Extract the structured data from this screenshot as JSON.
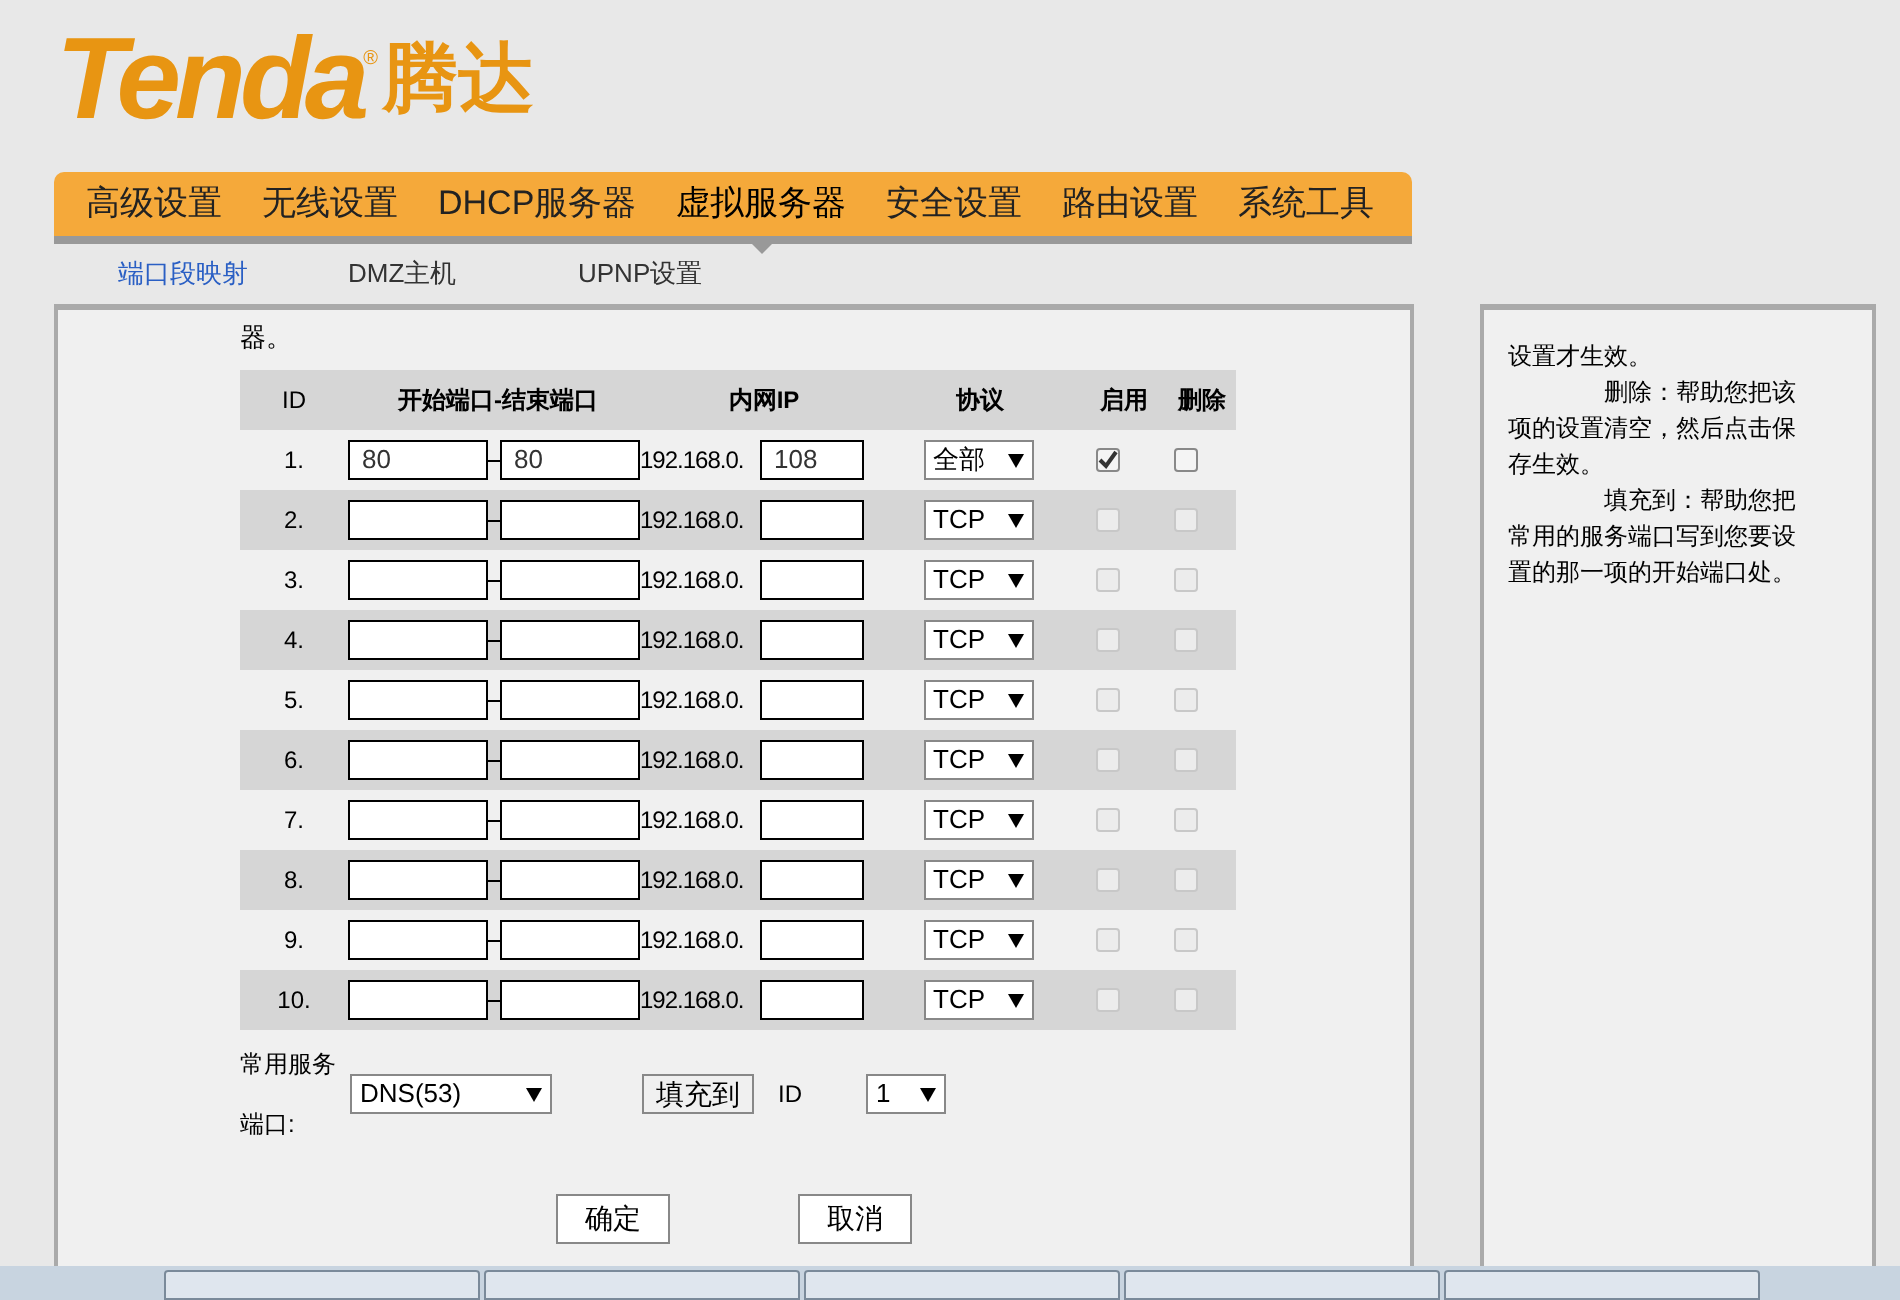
{
  "logo": {
    "brand": "Tenda",
    "mark": "®",
    "chinese": "腾达"
  },
  "nav": [
    {
      "label": "高级设置",
      "selected": false
    },
    {
      "label": "无线设置",
      "selected": false
    },
    {
      "label": "DHCP服务器",
      "selected": false
    },
    {
      "label": "虚拟服务器",
      "selected": true
    },
    {
      "label": "安全设置",
      "selected": false
    },
    {
      "label": "路由设置",
      "selected": false
    },
    {
      "label": "系统工具",
      "selected": false
    }
  ],
  "subtabs": [
    {
      "label": "端口段映射",
      "selected": true
    },
    {
      "label": "DMZ主机",
      "selected": false
    },
    {
      "label": "UPNP设置",
      "selected": false
    }
  ],
  "intro_tail": "器。",
  "table": {
    "columns": [
      "ID",
      "开始端口-结束端口",
      "内网IP",
      "协议",
      "启用",
      "删除"
    ],
    "rows": [
      {
        "id": "1.",
        "start": "80",
        "end": "80",
        "ip_prefix": "192.168.0.",
        "ip": "108",
        "protocol": "全部",
        "enabled": true,
        "enable_disabled": false,
        "delete": false
      },
      {
        "id": "2.",
        "ip_prefix": "192.168.0.",
        "protocol": "TCP",
        "enabled": false,
        "enable_disabled": true,
        "delete": false
      },
      {
        "id": "3.",
        "ip_prefix": "192.168.0.",
        "protocol": "TCP",
        "enabled": false,
        "enable_disabled": true,
        "delete": false
      },
      {
        "id": "4.",
        "ip_prefix": "192.168.0.",
        "protocol": "TCP",
        "enabled": false,
        "enable_disabled": true,
        "delete": false
      },
      {
        "id": "5.",
        "ip_prefix": "192.168.0.",
        "protocol": "TCP",
        "enabled": false,
        "enable_disabled": true,
        "delete": false
      },
      {
        "id": "6.",
        "ip_prefix": "192.168.0.",
        "protocol": "TCP",
        "enabled": false,
        "enable_disabled": true,
        "delete": false
      },
      {
        "id": "7.",
        "ip_prefix": "192.168.0.",
        "protocol": "TCP",
        "enabled": false,
        "enable_disabled": true,
        "delete": false
      },
      {
        "id": "8.",
        "ip_prefix": "192.168.0.",
        "protocol": "TCP",
        "enabled": false,
        "enable_disabled": true,
        "delete": false
      },
      {
        "id": "9.",
        "ip_prefix": "192.168.0.",
        "protocol": "TCP",
        "enabled": false,
        "enable_disabled": true,
        "delete": false
      },
      {
        "id": "10.",
        "ip_prefix": "192.168.0.",
        "protocol": "TCP",
        "enabled": false,
        "enable_disabled": true,
        "delete": false
      }
    ]
  },
  "common_service": {
    "label_line1": "常用服务",
    "label_line2": "端口:",
    "service": "DNS(53)",
    "fill_button": "填充到",
    "id_label": "ID",
    "id_value": "1"
  },
  "buttons": [
    "确定",
    "取消"
  ],
  "help": [
    "设置才生效。",
    "删除：帮助您把该",
    "项的设置清空，然后点击保",
    "存生效。",
    "填充到：帮助您把",
    "常用的服务端口写到您要设",
    "置的那一项的开始端口处。"
  ]
}
